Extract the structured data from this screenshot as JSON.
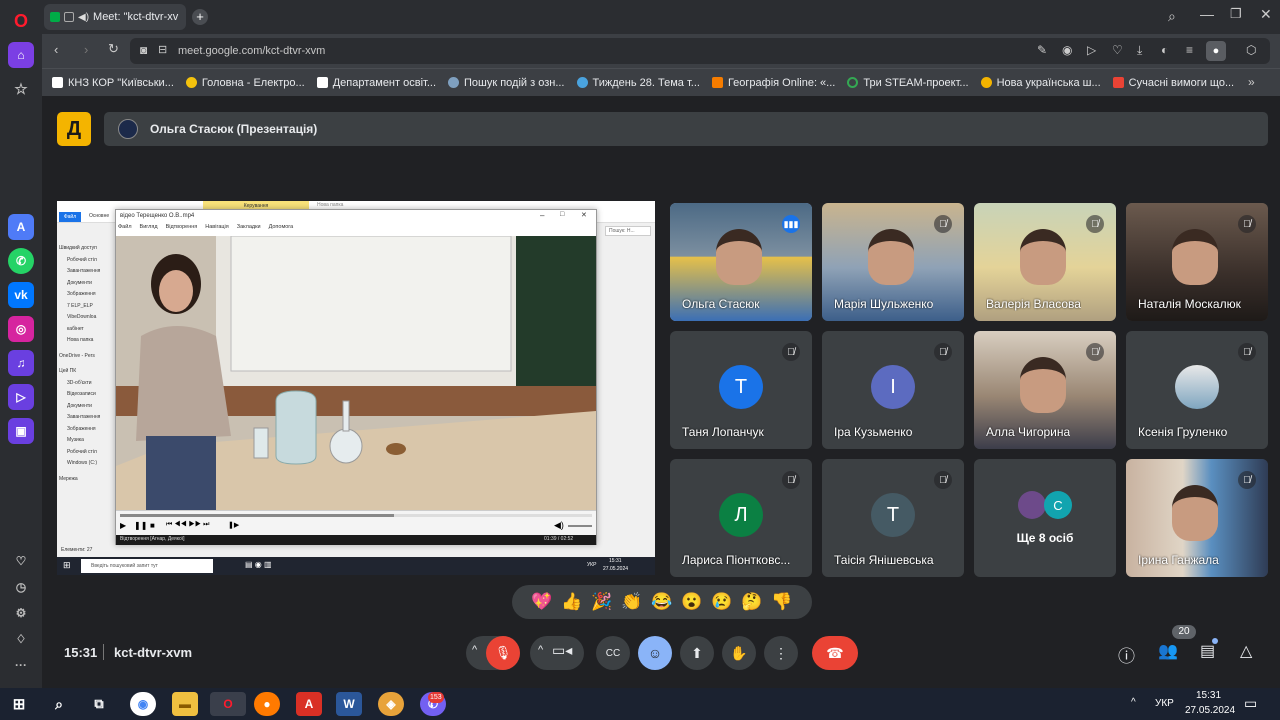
{
  "browser": {
    "tab_title": "Meet: \"kct-dtvr-xv",
    "url": "meet.google.com/kct-dtvr-xvm",
    "bookmarks": [
      {
        "label": "КНЗ КОР \"Київськи...",
        "color": "#ffffff"
      },
      {
        "label": "Головна - Електро...",
        "color": "#f4c20d"
      },
      {
        "label": "Департамент освіт...",
        "color": "#ffffff"
      },
      {
        "label": "Пошук подій з озн...",
        "color": "#7fa0c0"
      },
      {
        "label": "Тиждень 28. Тема т...",
        "color": "#4aa3df"
      },
      {
        "label": "Географія Online: «...",
        "color": "#f57c00"
      },
      {
        "label": "Три STEAM-проект...",
        "color": "#34a853"
      },
      {
        "label": "Нова українська ш...",
        "color": "#f4b400"
      },
      {
        "label": "Сучасні вимоги що...",
        "color": "#ea4335"
      }
    ]
  },
  "meet": {
    "presenter_label": "Ольга Стасюк (Презентація)",
    "logo_letter": "Д",
    "time": "15:31",
    "meeting_code": "kct-dtvr-xvm",
    "participants_count": "20",
    "reactions": [
      "💖",
      "👍",
      "🎉",
      "👏",
      "😂",
      "😮",
      "😢",
      "🤔",
      "👎"
    ],
    "participants": [
      {
        "name": "Ольга Стасюк",
        "type": "photo",
        "speaking": true
      },
      {
        "name": "Марія Шульженко",
        "type": "photo"
      },
      {
        "name": "Валерія Власова",
        "type": "photo"
      },
      {
        "name": "Наталія Москалюк",
        "type": "photo"
      },
      {
        "name": "Таня Лопанчук",
        "type": "avatar",
        "initial": "T",
        "color": "#1a73e8"
      },
      {
        "name": "Іра Кузьменко",
        "type": "avatar",
        "initial": "I",
        "color": "#5c6bc0"
      },
      {
        "name": "Алла Чигорина",
        "type": "photo"
      },
      {
        "name": "Ксенія Груленко",
        "type": "photo-avatar"
      },
      {
        "name": "Лариса Пiонтковс...",
        "type": "avatar",
        "initial": "Л",
        "color": "#0b8043"
      },
      {
        "name": "Таiсiя Янiшевська",
        "type": "avatar",
        "initial": "T",
        "color": "#455a64"
      },
      {
        "name": "Ще 8 осіб",
        "type": "more",
        "initial": "C"
      },
      {
        "name": "Ірина Ганжала",
        "type": "photo"
      }
    ]
  },
  "shared_screen": {
    "player_title": "відео Терещенко О.В..mp4",
    "player_menu": [
      "Файл",
      "Вигляд",
      "Відтворення",
      "Навігація",
      "Закладки",
      "Допомога"
    ],
    "ribbon_tab": "Керування",
    "new_folder": "Нова папка",
    "explorer_tabs": [
      "Файл",
      "Основне"
    ],
    "search_placeholder": "Пошук: Н...",
    "tree": [
      "Швидкий доступ",
      "Робочий стіл",
      "Завантаження",
      "Документи",
      "Зображення",
      "7 ELP_ELP",
      "VibeDownloa",
      "кабінет",
      "Нова папка",
      "OneDrive - Pers",
      "Цей ПК",
      "3D-об'єкти",
      "Відеозаписи",
      "Документи",
      "Завантаження",
      "Зображення",
      "Музика",
      "Робочий стіл",
      "Windows (C:)",
      "Мережа"
    ],
    "status_bar": "Відтворення [Агнар, Деякої]",
    "time_readout": "01:39 / 02:52",
    "elements_count": "Елементи: 27",
    "taskbar_search": "Введіть пошуковий запит тут",
    "taskbar_lang": "УКР",
    "taskbar_time": "15:31",
    "taskbar_date": "27.05.2024"
  },
  "taskbar": {
    "lang": "УКР",
    "time": "15:31",
    "date": "27.05.2024",
    "viber_badge": "153"
  }
}
